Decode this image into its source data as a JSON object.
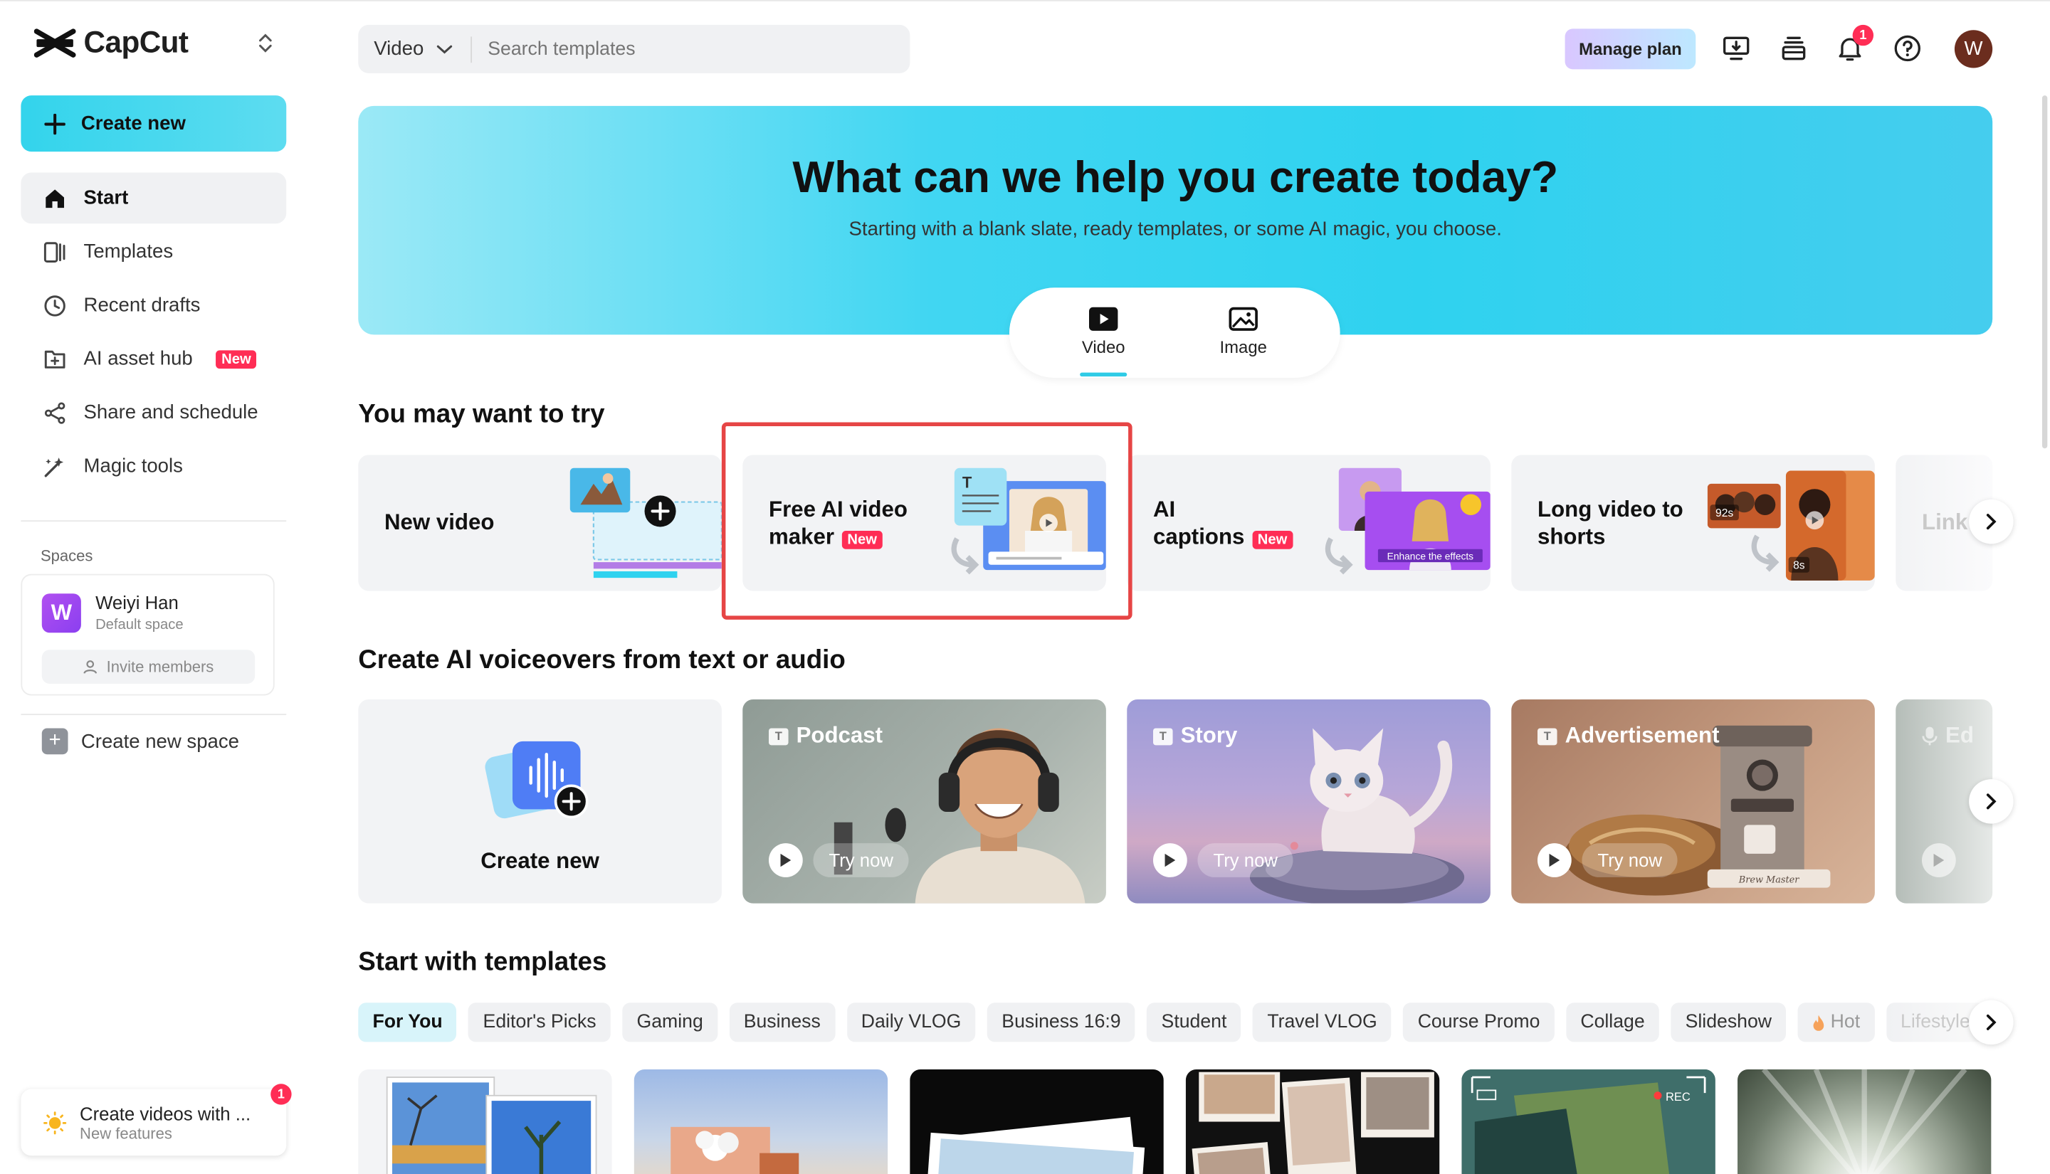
{
  "app": {
    "name": "CapCut"
  },
  "sidebar": {
    "create_label": "Create new",
    "items": [
      {
        "label": "Start",
        "icon": "home-icon"
      },
      {
        "label": "Templates",
        "icon": "templates-icon"
      },
      {
        "label": "Recent drafts",
        "icon": "clock-icon"
      },
      {
        "label": "AI asset hub",
        "icon": "asset-hub-icon",
        "badge": "New"
      },
      {
        "label": "Share and schedule",
        "icon": "share-icon"
      },
      {
        "label": "Magic tools",
        "icon": "magic-wand-icon"
      }
    ],
    "spaces_label": "Spaces",
    "space": {
      "avatar": "W",
      "name": "Weiyi Han",
      "sub": "Default space",
      "invite": "Invite members"
    },
    "new_space": "Create new space",
    "promo": {
      "title": "Create videos with ...",
      "sub": "New features",
      "badge": "1"
    }
  },
  "header": {
    "search_type": "Video",
    "search_placeholder": "Search templates",
    "manage_plan": "Manage plan",
    "notif_count": "1",
    "user_initial": "W"
  },
  "hero": {
    "title": "What can we help you create today?",
    "subtitle": "Starting with a blank slate, ready templates, or some AI magic, you choose.",
    "modes": [
      "Video",
      "Image"
    ],
    "active_mode": "Video"
  },
  "try_section": {
    "title": "You may want to try",
    "cards": [
      {
        "line1": "New video",
        "line2": ""
      },
      {
        "line1": "Free AI video",
        "line2": "maker",
        "badge": "New"
      },
      {
        "line1": "AI",
        "line2": "captions",
        "badge": "New",
        "overlay": "Enhance the effects"
      },
      {
        "line1": "Long video to",
        "line2": "shorts",
        "durations": [
          "92s",
          "8s"
        ]
      },
      {
        "line1": "Link",
        "line2": ""
      }
    ]
  },
  "voice_section": {
    "title": "Create AI voiceovers from text or audio",
    "create_label": "Create new",
    "cards": [
      {
        "label": "Podcast",
        "cta": "Try now"
      },
      {
        "label": "Story",
        "cta": "Try now"
      },
      {
        "label": "Advertisement",
        "cta": "Try now"
      },
      {
        "label": "Ed",
        "cta": ""
      }
    ],
    "machine_text": "Brew Master"
  },
  "templates_section": {
    "title": "Start with templates",
    "chips": [
      "For You",
      "Editor's Picks",
      "Gaming",
      "Business",
      "Daily VLOG",
      "Business 16:9",
      "Student",
      "Travel VLOG",
      "Course Promo",
      "Collage",
      "Slideshow",
      "Hot",
      "Lifestyle"
    ],
    "rec_label": "REC"
  },
  "colors": {
    "accent": "#2fd2ef",
    "badge_red": "#ff2d55",
    "highlight_box": "#e64545"
  }
}
